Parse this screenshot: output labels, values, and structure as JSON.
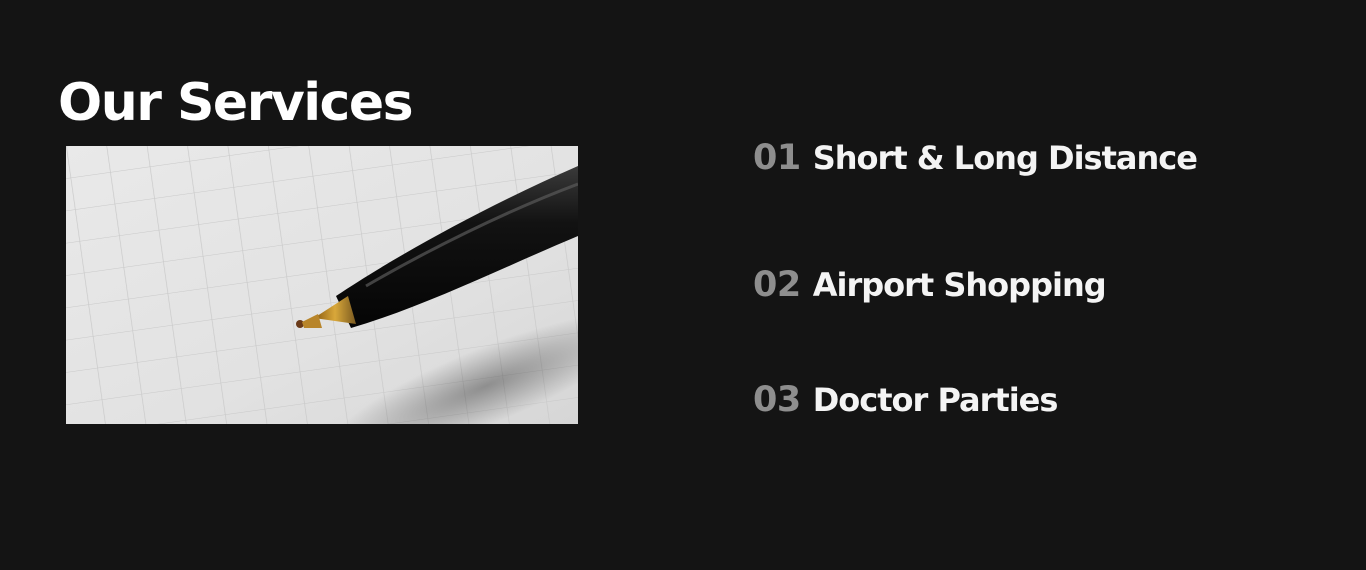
{
  "section": {
    "title": "Our Services",
    "image_icon": "pen-photo"
  },
  "services": [
    {
      "number": "01",
      "label": "Short & Long Distance"
    },
    {
      "number": "02",
      "label": "Airport Shopping"
    },
    {
      "number": "03",
      "label": "Doctor Parties"
    }
  ],
  "colors": {
    "background": "#141414",
    "title": "#ffffff",
    "number": "#8e8e8e",
    "label": "#f4f4f4"
  }
}
